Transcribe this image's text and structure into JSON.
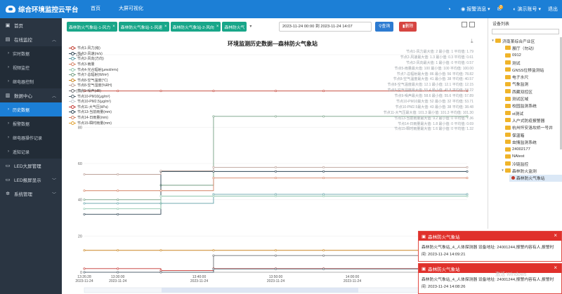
{
  "app": {
    "title": "综合环境监控云平台"
  },
  "nav": [
    "首页",
    "大屏可视化"
  ],
  "topright": {
    "alarm": "报警消息",
    "badge": "2",
    "user": "演示账号",
    "logout": "退出"
  },
  "sidebar": {
    "home": "首页",
    "online": "在线监控",
    "online_sub": [
      "实时数据",
      "视频监控",
      "继电器控制"
    ],
    "datacenter": "数据中心",
    "datacenter_sub": [
      "历史数据",
      "报警数据",
      "继电器操作记录",
      "遥知记录"
    ],
    "led_screen": "LED大屏管理",
    "led_display": "LED报屏显示",
    "system": "系统管理"
  },
  "tabs": [
    "森林防火气象站-1-风力",
    "森林防火气象站-1-风速",
    "森林防火气象站-2-风向",
    "森林防火气"
  ],
  "query": {
    "daterange": "2023-11-24 00:00 到 2023-11-24 14:07",
    "search": "查询",
    "delete": "删除"
  },
  "chart": {
    "title": "环境监测历史数据—森林防火气象站",
    "legend": [
      {
        "name": "节点1-风力(级)",
        "color": "#c0392b"
      },
      {
        "name": "节点2-风速(m/s)",
        "color": "#2f4554"
      },
      {
        "name": "节点2-风向(方向)",
        "color": "#61a0a8"
      },
      {
        "name": "节点3-雨量",
        "color": "#d48265"
      },
      {
        "name": "节点4-光合辐射(μmol/m²s)",
        "color": "#91c7ae"
      },
      {
        "name": "节点7-总辐射(W/m²)",
        "color": "#749f83"
      },
      {
        "name": "节点8-空气温度(℃)",
        "color": "#ca8622"
      },
      {
        "name": "节点8-空气湿度(%RH)",
        "color": "#bda29a"
      },
      {
        "name": "节点9-噪声(dB)",
        "color": "#6e7074"
      },
      {
        "name": "节点10-PM10(μg/m³)",
        "color": "#546570"
      },
      {
        "name": "节点10-PM2.5(μg/m³)",
        "color": "#c4ccd3"
      },
      {
        "name": "节点11-大气压(kPa)",
        "color": "#c23531"
      },
      {
        "name": "节点13-当前雨量(mm)",
        "color": "#2f4554"
      },
      {
        "name": "节点14-日雨量(mm)",
        "color": "#d48265"
      },
      {
        "name": "节点15-瞬时雨量(mm)",
        "color": "#e0a030"
      }
    ],
    "stats": [
      "节点1-风力最大值: 2  最小值: 1  平均值: 1.79",
      "节点2-风速最大值: 1.3  最小值: 0.3  平均值: 0.61",
      "节点2-风向最大值: 1  最小值: 0  平均值: 0.57",
      "节点5-雨量最大值: 100  最小值: 100  平均值: 100.00",
      "节点7-总辐射最大值: 86  最小值: 56  平均值: 78.82",
      "节点8-空气温度最大值: 41  最小值: 38  平均值: 40.57",
      "节点8-空气温度最大值: 12.1  最小值: 12.1  平均值: 12.15",
      "节点9-空气湿度最大值: 55.4  最小值: 45.8  平均值: 53.22",
      "节点9-噪声最大值: 58.6  最小值: 55.6  平均值: 57.89",
      "节点10-PM10最大值: 52  最小值: 32  平均值: 53.71",
      "节点10-PM2.5最大值: 43  最小值: 38  平均值: 38.48",
      "节点11-大气压最大值: 101.3  最小值: 101.3  平均值: 101.30",
      "节点13-当前雨量最大值: 9.2  最小值: 0  平均值: 7.36",
      "节点14-日雨量最大值: 1.8  最小值: 0  平均值: 0.69",
      "节点15-瞬时雨量最大值: 1.6  最小值: 0  平均值: 1.32"
    ]
  },
  "chart_data": {
    "type": "line",
    "title": "环境监测历史数据—森林防火气象站",
    "ylim": [
      0,
      120
    ],
    "yticks": [
      "0",
      "20",
      "40",
      "60",
      "80",
      "100",
      "120"
    ],
    "xticks": [
      "13:26:28\n2023-11-24",
      "13:30:00\n2023-11-24",
      "13:40:00\n2023-11-24",
      "13:50:00\n2023-11-24",
      "14:00:00\n2023-11-24",
      "14:0"
    ],
    "x": [
      0,
      3.5,
      8,
      13.5,
      20,
      25,
      40
    ],
    "series": [
      {
        "name": "节点5-雨量",
        "color": "#c0392b",
        "values": [
          100,
          100,
          100,
          100,
          100,
          100,
          100
        ]
      },
      {
        "name": "节点7-总辐射(W/m²)",
        "color": "#749f83",
        "values": [
          40,
          40,
          48,
          86,
          86,
          86,
          86
        ]
      },
      {
        "name": "节点9-噪声(dB)",
        "color": "#2f4554",
        "values": [
          32,
          32,
          55.6,
          55.6,
          55.6,
          55.6,
          55.6
        ]
      },
      {
        "name": "节点10-PM10(μg/m³)",
        "color": "#d48265",
        "values": [
          45,
          45,
          45,
          52,
          52,
          52,
          52
        ]
      },
      {
        "name": "节点8-空气湿度(%RH)",
        "color": "#bda29a",
        "values": [
          54,
          54,
          56,
          57.9,
          57.9,
          57.9,
          57.9
        ]
      },
      {
        "name": "节点10-PM2.5(μg/m³)",
        "color": "#61a0a8",
        "values": [
          38,
          38,
          38,
          43,
          43,
          43,
          43
        ]
      },
      {
        "name": "节点11-大气压(kPa)",
        "color": "#91c7ae",
        "values": [
          35,
          35,
          42,
          42,
          42,
          42,
          42
        ]
      },
      {
        "name": "节点8-空气温度(℃)",
        "color": "#ca8622",
        "values": [
          12.1,
          12.1,
          12.1,
          12.1,
          12.1,
          12.1,
          12.1
        ]
      },
      {
        "name": "节点13-当前雨量(mm)",
        "color": "#6e7074",
        "values": [
          0,
          0,
          0,
          9.2,
          9.2,
          9.2,
          9.2
        ]
      },
      {
        "name": "节点1-风力(级)",
        "color": "#c23531",
        "values": [
          2,
          2,
          1,
          2,
          2,
          2,
          2
        ]
      },
      {
        "name": "节点14-日雨量(mm)",
        "color": "#546570",
        "values": [
          0,
          0,
          0,
          1.8,
          1.8,
          1.8,
          1.8
        ]
      }
    ]
  },
  "tree": {
    "header": "设备列表",
    "items": [
      {
        "label": "济南某综合产业区",
        "level": 0,
        "toggle": "▾"
      },
      {
        "label": "展厅（勿动）",
        "level": 1
      },
      {
        "label": "0912",
        "level": 1
      },
      {
        "label": "测试",
        "level": 1
      },
      {
        "label": "GNSS位移监测站",
        "level": 1
      },
      {
        "label": "电子水尺",
        "level": 1
      },
      {
        "label": "气象监测",
        "level": 1
      },
      {
        "label": "西藏双控区",
        "level": 1
      },
      {
        "label": "测试区域",
        "level": 1
      },
      {
        "label": "校园监测系统",
        "level": 1
      },
      {
        "label": "xt测试",
        "level": 1
      },
      {
        "label": "人户式防疫报警器",
        "level": 1
      },
      {
        "label": "杭州怀安洛坎桥一号井",
        "level": 1
      },
      {
        "label": "保温箱",
        "level": 1
      },
      {
        "label": "虫情监测系统",
        "level": 1
      },
      {
        "label": "24002177",
        "level": 1
      },
      {
        "label": "NAtest",
        "level": 1
      },
      {
        "label": "冷链监控",
        "level": 1
      },
      {
        "label": "森林防火监测",
        "level": 1,
        "toggle": "▾"
      }
    ],
    "station": "森林防火气象站"
  },
  "popups": [
    {
      "title": "森林防火气象站",
      "body": "森林防火气象站_4_人体探测器 设备地址: 24001244,报警内容有人,报警时间: 2023-11-24 14:09:21"
    },
    {
      "title": "森林防火气象站",
      "body": "森林防火气象站_4_人体探测器 设备地址: 24001244,报警内容有人,报警时间: 2023-11-24 14:08:26"
    }
  ],
  "watermark": "激活 Windows"
}
